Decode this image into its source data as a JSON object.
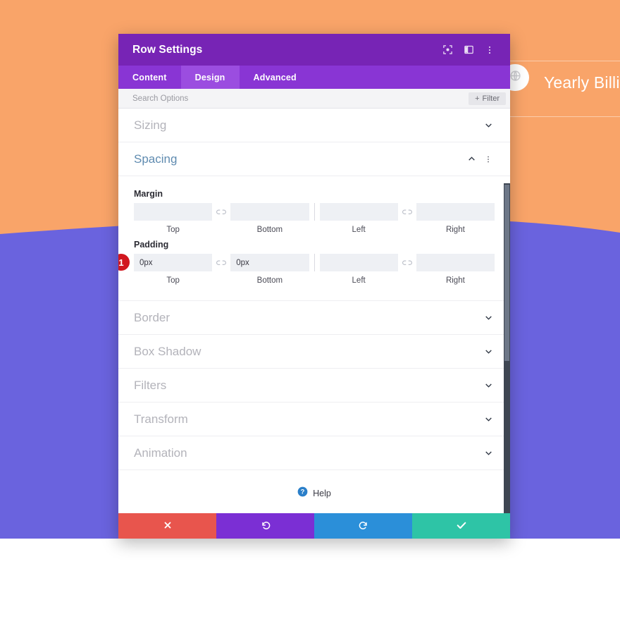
{
  "background": {
    "colors": {
      "orange": "#f9a469",
      "purple": "#6a63de"
    },
    "yearly_billing_label": "Yearly Billing",
    "toggle_icon": "globe-icon"
  },
  "modal": {
    "title": "Row Settings",
    "titlebar_icons": [
      {
        "name": "focus-icon"
      },
      {
        "name": "layout-columns-icon"
      },
      {
        "name": "vertical-dots-icon"
      }
    ],
    "tabs": [
      {
        "label": "Content",
        "active": false
      },
      {
        "label": "Design",
        "active": true
      },
      {
        "label": "Advanced",
        "active": false
      }
    ],
    "search": {
      "placeholder": "Search Options",
      "value": ""
    },
    "filter_button": {
      "label": "Filter",
      "icon": "plus-icon"
    },
    "sections": [
      {
        "name": "sizing",
        "title": "Sizing",
        "open": false
      },
      {
        "name": "spacing",
        "title": "Spacing",
        "open": true
      },
      {
        "name": "border",
        "title": "Border",
        "open": false
      },
      {
        "name": "box-shadow",
        "title": "Box Shadow",
        "open": false
      },
      {
        "name": "filters",
        "title": "Filters",
        "open": false
      },
      {
        "name": "transform",
        "title": "Transform",
        "open": false
      },
      {
        "name": "animation",
        "title": "Animation",
        "open": false
      }
    ],
    "spacing": {
      "margin": {
        "label": "Margin",
        "fields": [
          {
            "label": "Top",
            "value": "",
            "placeholder": ""
          },
          {
            "label": "Bottom",
            "value": "",
            "placeholder": ""
          },
          {
            "label": "Left",
            "value": "",
            "placeholder": ""
          },
          {
            "label": "Right",
            "value": "",
            "placeholder": ""
          }
        ]
      },
      "padding": {
        "label": "Padding",
        "badge": "1",
        "badge_color": "#d1171f",
        "fields": [
          {
            "label": "Top",
            "value": "0px",
            "placeholder": ""
          },
          {
            "label": "Bottom",
            "value": "0px",
            "placeholder": ""
          },
          {
            "label": "Left",
            "value": "",
            "placeholder": ""
          },
          {
            "label": "Right",
            "value": "",
            "placeholder": ""
          }
        ]
      },
      "link_icon": "link-icon"
    },
    "help": {
      "label": "Help",
      "icon": "question-circle-icon"
    },
    "footer": [
      {
        "name": "cancel",
        "icon": "close-x-icon",
        "color": "#e8554d"
      },
      {
        "name": "undo",
        "icon": "undo-arrow-icon",
        "color": "#7b2fd4"
      },
      {
        "name": "redo",
        "icon": "redo-arrow-icon",
        "color": "#2b8fd9"
      },
      {
        "name": "save",
        "icon": "checkmark-icon",
        "color": "#2ec4a6"
      }
    ]
  }
}
